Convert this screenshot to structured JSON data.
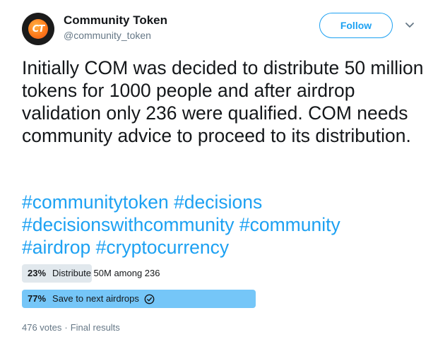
{
  "user": {
    "display_name": "Community Token",
    "handle": "@community_token",
    "avatar_icon": "community-token-logo",
    "avatar_initials": "CT"
  },
  "follow_label": "Follow",
  "menu_icon": "chevron-down-icon",
  "tweet_text": "Initially COM was decided to distribute 50 million tokens for 1000 people and after airdrop validation only 236 were qualified. COM needs community advice to proceed to its distribution.",
  "hashtags": [
    "#communitytoken",
    "#decisions",
    "#decisionswithcommunity",
    "#community",
    "#airdrop",
    "#cryptocurrency"
  ],
  "poll": {
    "options": [
      {
        "percent_label": "23%",
        "percent": 23,
        "label": "Distribute 50M among 236",
        "winner": false
      },
      {
        "percent_label": "77%",
        "percent": 77,
        "label": "Save to next airdrops",
        "winner": true
      }
    ],
    "votes": "476 votes",
    "status": "Final results"
  },
  "colors": {
    "accent": "#1da1f2",
    "winner_bar": "#75c6f8",
    "loser_bar": "#e1e8ed",
    "secondary_text": "#657786"
  }
}
